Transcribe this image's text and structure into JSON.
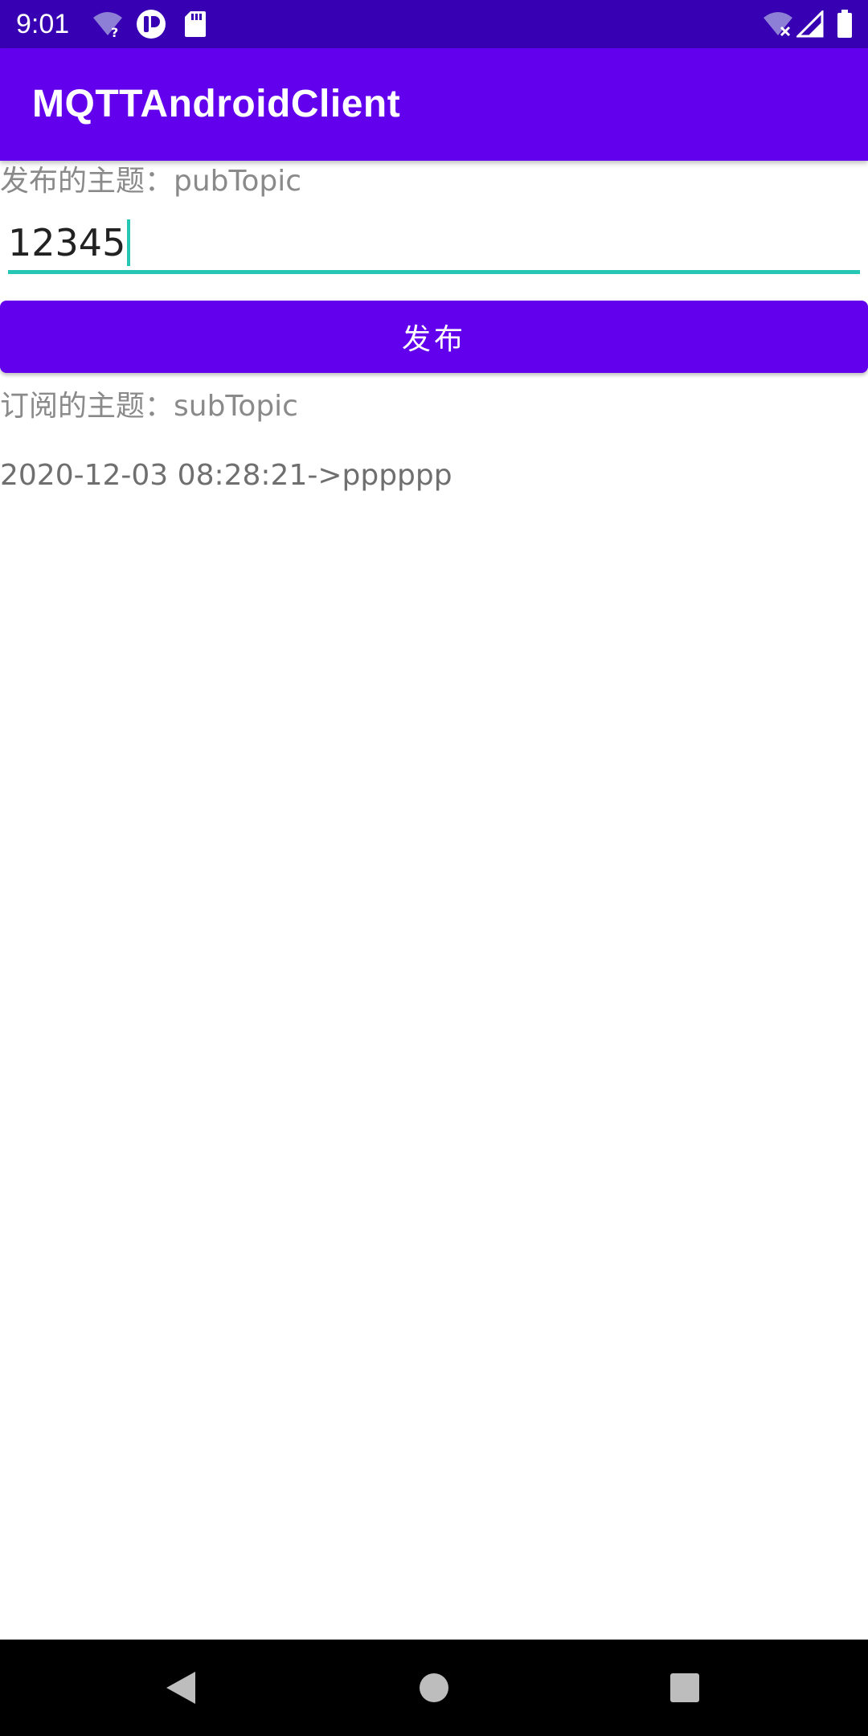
{
  "status_bar": {
    "time": "9:01",
    "icons_left": [
      "wifi-unknown-icon",
      "app-notification-icon",
      "sd-card-icon"
    ],
    "icons_right": [
      "wifi-off-icon",
      "cell-signal-icon",
      "battery-icon"
    ],
    "background": "#3700B3"
  },
  "app_bar": {
    "title": "MQTTAndroidClient",
    "background": "#6200EE"
  },
  "publish": {
    "topic_label": "发布的主题：pubTopic",
    "input_value": "12345",
    "button_label": "发布",
    "accent": "#26C6B4"
  },
  "subscribe": {
    "topic_label": "订阅的主题：subTopic",
    "messages": [
      "2020-12-03 08:28:21->pppppp"
    ]
  },
  "nav_bar": {
    "buttons": [
      "back-icon",
      "home-icon",
      "recents-icon"
    ]
  }
}
